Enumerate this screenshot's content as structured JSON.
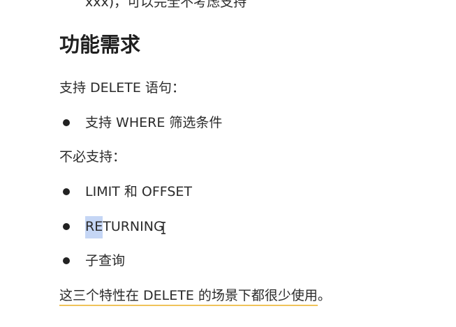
{
  "doc": {
    "cut_off_line": "xxx)，可以完全不考虑支持",
    "heading": "功能需求",
    "support_intro": "支持 DELETE 语句：",
    "supported_items": [
      "支持 WHERE 筛选条件"
    ],
    "not_required_intro": "不必支持：",
    "not_required_items": [
      "LIMIT 和 OFFSET",
      {
        "selected": "RE",
        "rest": "TURNING"
      },
      "子查询"
    ],
    "closing_note": "这三个特性在 DELETE 的场景下都很少使用",
    "closing_punct": "。"
  },
  "colors": {
    "selection": "#c5d6f5",
    "underline": "#f0c35a",
    "text": "#2a2a2a"
  },
  "icons": {
    "cursor": "i-beam-cursor-icon",
    "bullet": "bullet-dot-icon"
  }
}
